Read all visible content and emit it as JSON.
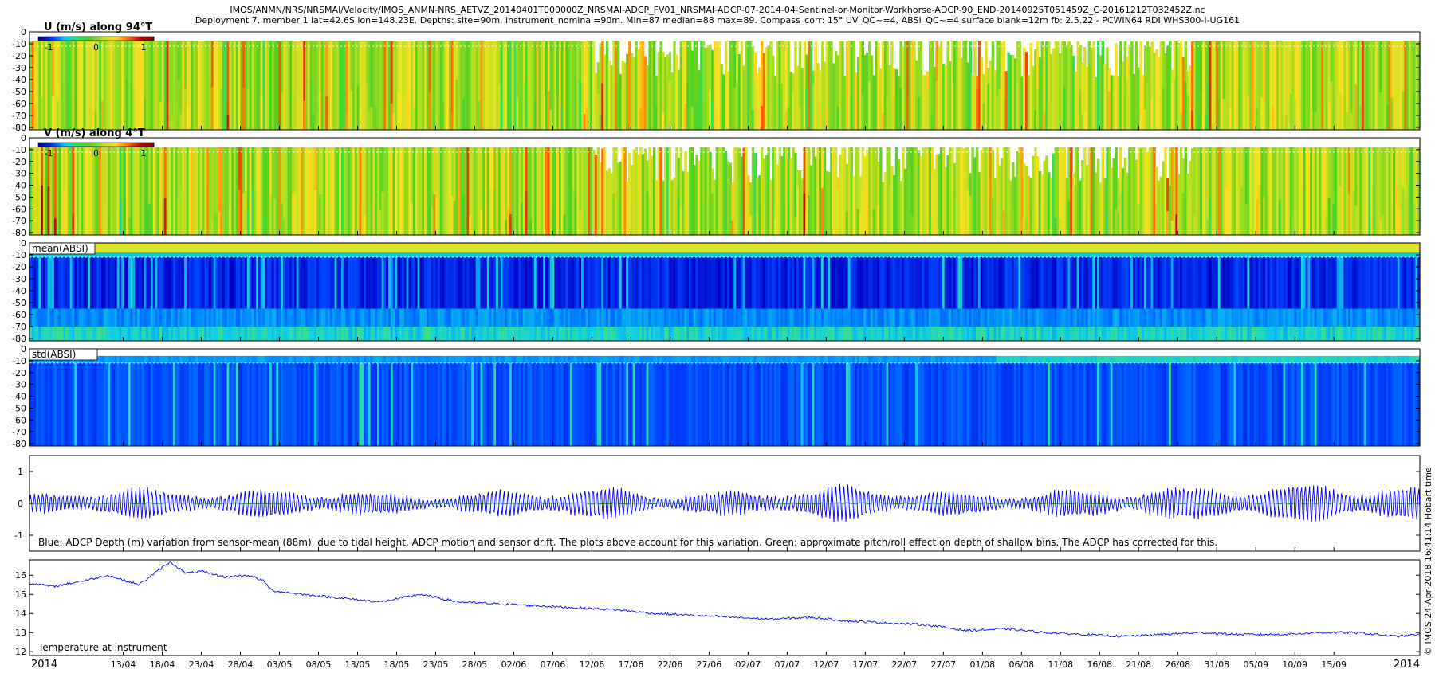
{
  "header": {
    "line1": "IMOS/ANMN/NRS/NRSMAI/Velocity/IMOS_ANMN-NRS_AETVZ_20140401T000000Z_NRSMAI-ADCP_FV01_NRSMAI-ADCP-07-2014-04-Sentinel-or-Monitor-Workhorse-ADCP-90_END-20140925T051459Z_C-20161212T032452Z.nc",
    "line2": "Deployment 7, member 1 lat=42.6S lon=148.23E. Depths: site=90m, instrument_nominal=90m. Min=87 median=88 max=89. Compass_corr: 15° UV_QC~=4, ABSI_QC~=4 surface blank=12m fb: 2.5.22 - PCWIN64 RDI WHS300-I-UG161"
  },
  "side_label": "© IMOS 24-Apr-2018 16:41:14 Hobart time",
  "colors": {
    "line_blue": "#0000ff",
    "line_green": "#008800",
    "frame": "#000000",
    "u_v_colormap": [
      "#000090",
      "#0030ff",
      "#00c8ff",
      "#30e060",
      "#50d020",
      "#b0e020",
      "#ffe020",
      "#ff7000",
      "#c00000",
      "#800000"
    ],
    "absi_colormap": [
      "#000080",
      "#0000c0",
      "#0040ff",
      "#0090ff",
      "#10d0e0",
      "#40e080",
      "#a0e040",
      "#ffe020"
    ]
  },
  "chart_data": [
    {
      "type": "heatmap",
      "name": "u",
      "label": "U (m/s) along 94°T",
      "colorbar_ticks": [
        "-1",
        "0",
        "1"
      ],
      "clim": [
        -1.2,
        1.2
      ],
      "yticks": [
        0,
        -10,
        -20,
        -30,
        -40,
        -50,
        -60,
        -70,
        -80
      ],
      "ylim": [
        -82,
        0
      ],
      "blank_top_depth": -8,
      "surface_blank_line": -12
    },
    {
      "type": "heatmap",
      "name": "v",
      "label": "V (m/s) along 4°T",
      "colorbar_ticks": [
        "-1",
        "0",
        "1"
      ],
      "clim": [
        -1.2,
        1.2
      ],
      "yticks": [
        0,
        -10,
        -20,
        -30,
        -40,
        -50,
        -60,
        -70,
        -80
      ],
      "ylim": [
        -82,
        0
      ],
      "blank_top_depth": -8,
      "surface_blank_line": -12
    },
    {
      "type": "heatmap",
      "name": "mean_absi",
      "label": "mean(ABSI)",
      "yticks": [
        0,
        -10,
        -20,
        -30,
        -40,
        -50,
        -60,
        -70,
        -80
      ],
      "ylim": [
        -82,
        0
      ],
      "surface_blank_line": -12
    },
    {
      "type": "heatmap",
      "name": "std_absi",
      "label": "std(ABSI)",
      "yticks": [
        0,
        -10,
        -20,
        -30,
        -40,
        -50,
        -60,
        -70,
        -80
      ],
      "ylim": [
        -82,
        0
      ],
      "surface_blank_line": -12
    },
    {
      "type": "line",
      "name": "depth_variation",
      "caption": "Blue: ADCP Depth (m) variation from sensor-mean (88m), due to tidal height, ADCP motion and sensor drift. The plots above account for this variation. Green: approximate pitch/roll effect on depth of shallow bins. The ADCP has corrected for this.",
      "yticks": [
        1,
        0,
        -1
      ],
      "ylim": [
        -1.5,
        1.5
      ],
      "amplitude_envelope": [
        0.3,
        0.5,
        0.45,
        0.4,
        0.5,
        0.35,
        0.3,
        0.45,
        0.55,
        0.4,
        0.35,
        0.5,
        0.6,
        0.4,
        0.35,
        0.45,
        0.5,
        0.55,
        0.6,
        0.7,
        0.5
      ]
    },
    {
      "type": "line",
      "name": "temperature",
      "caption": "Temperature at instrument",
      "yticks": [
        16,
        15,
        14,
        13,
        12
      ],
      "ylim": [
        11.8,
        16.8
      ],
      "x_days_from_start": [
        0,
        3,
        8,
        10,
        14,
        17,
        18,
        20,
        22,
        25,
        28,
        30,
        31,
        35,
        40,
        45,
        50,
        55,
        60,
        65,
        70,
        75,
        80,
        85,
        90,
        95,
        100,
        105,
        110,
        115,
        120,
        125,
        130,
        135,
        140,
        145,
        150,
        155,
        160,
        165,
        170,
        175,
        178
      ],
      "values": [
        15.6,
        15.4,
        15.8,
        16.0,
        15.5,
        16.4,
        16.7,
        16.1,
        16.2,
        15.9,
        16.0,
        15.7,
        15.2,
        15.0,
        14.8,
        14.6,
        15.0,
        14.6,
        14.5,
        14.4,
        14.3,
        14.2,
        14.0,
        13.9,
        13.8,
        13.7,
        13.8,
        13.6,
        13.5,
        13.4,
        13.1,
        13.2,
        13.0,
        12.9,
        12.8,
        12.9,
        13.0,
        12.9,
        12.9,
        13.0,
        13.0,
        12.8,
        12.9
      ]
    }
  ],
  "x_axis": {
    "date_ticks": [
      "2014",
      "13/04",
      "18/04",
      "23/04",
      "28/04",
      "03/05",
      "08/05",
      "13/05",
      "18/05",
      "23/05",
      "28/05",
      "02/06",
      "07/06",
      "12/06",
      "17/06",
      "22/06",
      "27/06",
      "02/07",
      "07/07",
      "12/07",
      "17/07",
      "22/07",
      "27/07",
      "01/08",
      "06/08",
      "11/08",
      "16/08",
      "21/08",
      "26/08",
      "31/08",
      "05/09",
      "10/09",
      "15/09",
      "2014"
    ],
    "tick_days_from_start": [
      0,
      12,
      17,
      22,
      27,
      32,
      37,
      42,
      47,
      52,
      57,
      62,
      67,
      72,
      77,
      82,
      87,
      92,
      97,
      102,
      107,
      112,
      117,
      122,
      127,
      132,
      137,
      142,
      147,
      152,
      157,
      162,
      167,
      178
    ],
    "total_days": 178
  }
}
